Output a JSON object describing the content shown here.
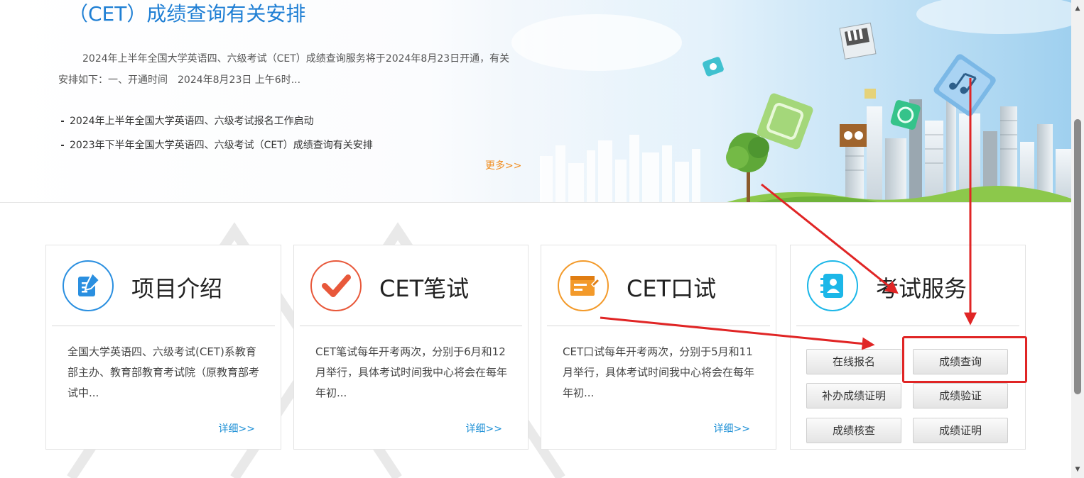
{
  "news": {
    "title": "（CET）成绩查询有关安排",
    "summary": "2024年上半年全国大学英语四、六级考试（CET）成绩查询服务将于2024年8月23日开通，有关安排如下：一、开通时间　2024年8月23日 上午6时...",
    "items": [
      "2024年上半年全国大学英语四、六级考试报名工作启动",
      "2023年下半年全国大学英语四、六级考试（CET）成绩查询有关安排"
    ],
    "more_label": "更多>>"
  },
  "cards": [
    {
      "title": "项目介绍",
      "icon": "document-edit-icon",
      "desc": "全国大学英语四、六级考试(CET)系教育部主办、教育部教育考试院（原教育部考试中...",
      "more_label": "详细>>"
    },
    {
      "title": "CET笔试",
      "icon": "checkmark-icon",
      "desc": "CET笔试每年开考两次，分别于6月和12月举行，具体考试时间我中心将会在每年年初...",
      "more_label": "详细>>"
    },
    {
      "title": "CET口试",
      "icon": "screen-pen-icon",
      "desc": "CET口试每年开考两次，分别于5月和11月举行，具体考试时间我中心将会在每年年初...",
      "more_label": "详细>>"
    }
  ],
  "services": {
    "title": "考试服务",
    "icon": "contact-book-icon",
    "buttons": {
      "register": "在线报名",
      "score_query": "成绩查询",
      "reissue_certificate": "补办成绩证明",
      "score_verify": "成绩验证",
      "score_review": "成绩核查",
      "score_certificate": "成绩证明"
    }
  },
  "colors": {
    "title_blue": "#1f7fd4",
    "more_orange": "#f08c1e",
    "link_blue": "#1e90d6",
    "annotation_red": "#e02525",
    "icon_blue": "#2a8fe0",
    "icon_orange_red": "#e8583a",
    "icon_orange": "#f39a2a",
    "icon_cyan": "#1cb7e8"
  }
}
